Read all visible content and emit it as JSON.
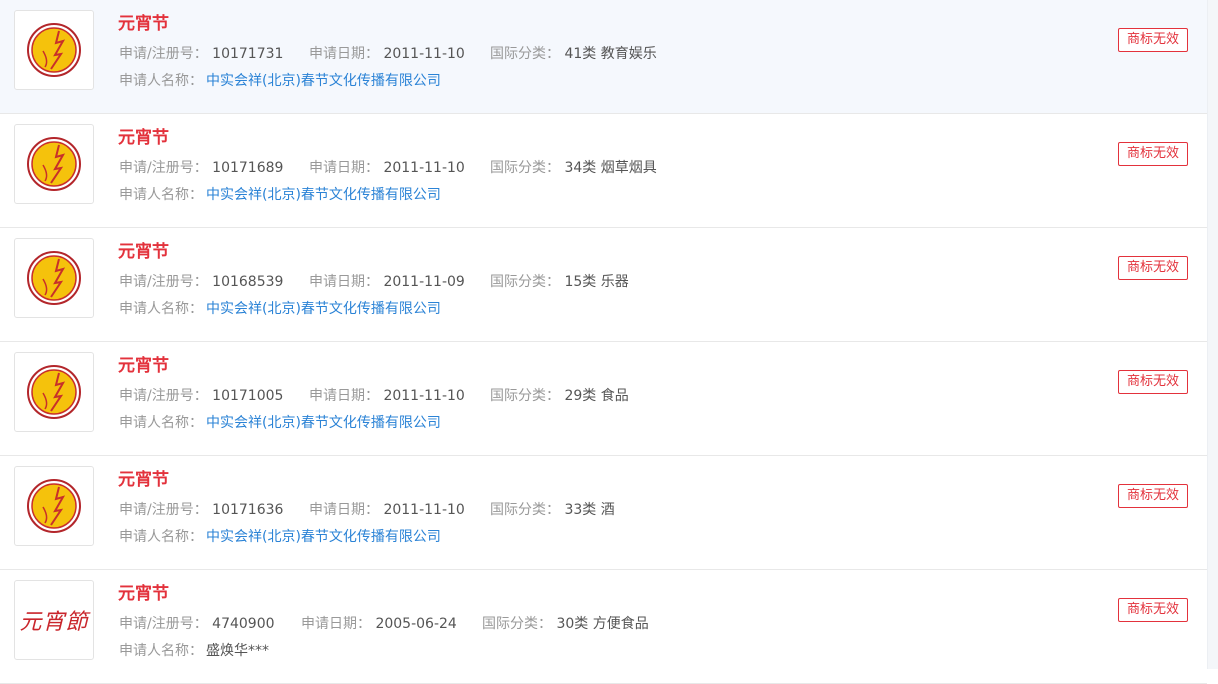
{
  "labels": {
    "regno": "申请/注册号：",
    "date": "申请日期：",
    "intl_class": "国际分类：",
    "applicant": "申请人名称："
  },
  "colors": {
    "title": "#e3323c",
    "link": "#2b83d6",
    "status": "#e3323c",
    "row_hover": "#f5f8fd"
  },
  "results": [
    {
      "name": "元宵节",
      "regno": "10171731",
      "date": "2011-11-10",
      "intl_class": "41类 教育娱乐",
      "applicant": "中实会祥(北京)春节文化传播有限公司",
      "status": "商标无效",
      "logo": "round-seal-logo-icon"
    },
    {
      "name": "元宵节",
      "regno": "10171689",
      "date": "2011-11-10",
      "intl_class": "34类 烟草烟具",
      "applicant": "中实会祥(北京)春节文化传播有限公司",
      "status": "商标无效",
      "logo": "round-seal-logo-icon"
    },
    {
      "name": "元宵节",
      "regno": "10168539",
      "date": "2011-11-09",
      "intl_class": "15类 乐器",
      "applicant": "中实会祥(北京)春节文化传播有限公司",
      "status": "商标无效",
      "logo": "round-seal-logo-icon"
    },
    {
      "name": "元宵节",
      "regno": "10171005",
      "date": "2011-11-10",
      "intl_class": "29类 食品",
      "applicant": "中实会祥(北京)春节文化传播有限公司",
      "status": "商标无效",
      "logo": "round-seal-logo-icon"
    },
    {
      "name": "元宵节",
      "regno": "10171636",
      "date": "2011-11-10",
      "intl_class": "33类 酒",
      "applicant": "中实会祥(北京)春节文化传播有限公司",
      "status": "商标无效",
      "logo": "round-seal-logo-icon"
    },
    {
      "name": "元宵节",
      "regno": "4740900",
      "date": "2005-06-24",
      "intl_class": "30类 方便食品",
      "applicant": "盛焕华***",
      "status": "商标无效",
      "logo": "calligraphy-logo",
      "logo_text": "元宵節"
    }
  ]
}
